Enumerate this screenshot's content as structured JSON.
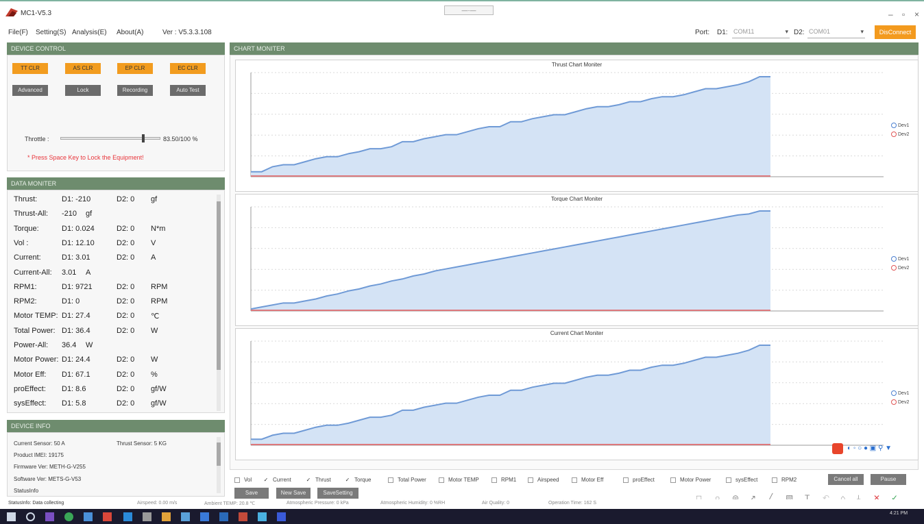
{
  "window": {
    "title": "MC1-V5.3",
    "grip": "—·—"
  },
  "menu": {
    "items": [
      "File(F)",
      "Setting(S)",
      "Analysis(E)",
      "About(A)"
    ],
    "version": "Ver : V5.3.3.108"
  },
  "port": {
    "label": "Port:",
    "d1_label": "D1:",
    "d1_value": "COM11",
    "d2_label": "D2:",
    "d2_value": "COM01",
    "disconnect": "DisConnect"
  },
  "device_control": {
    "header": "DEVICE CONTROL",
    "clear_buttons": [
      "TT CLR",
      "AS CLR",
      "EP CLR",
      "EC CLR"
    ],
    "mode_buttons": [
      "Advanced",
      "Lock",
      "Recording",
      "Auto Test"
    ],
    "throttle_label": "Throttle :",
    "throttle_value": "83.50/100 %",
    "throttle_fraction": 0.835,
    "warning": "* Press Space Key to Lock the Equipment!"
  },
  "data_monitor": {
    "header": "DATA MONITER",
    "rows": [
      {
        "label": "Thrust:",
        "d1": "D1: -210",
        "d2": "D2: 0",
        "unit": "gf"
      },
      {
        "label": "Thrust-All:",
        "d1": "-210",
        "d2": "",
        "unit": "gf"
      },
      {
        "label": "Torque:",
        "d1": "D1: 0.024",
        "d2": "D2: 0",
        "unit": "N*m"
      },
      {
        "label": "Vol :",
        "d1": "D1: 12.10",
        "d2": "D2: 0",
        "unit": "V"
      },
      {
        "label": "Current:",
        "d1": "D1: 3.01",
        "d2": "D2: 0",
        "unit": "A"
      },
      {
        "label": "Current-All:",
        "d1": "3.01",
        "d2": "",
        "unit": "A"
      },
      {
        "label": "RPM1:",
        "d1": "D1: 9721",
        "d2": "D2: 0",
        "unit": "RPM"
      },
      {
        "label": "RPM2:",
        "d1": "D1: 0",
        "d2": "D2: 0",
        "unit": "RPM"
      },
      {
        "label": "Motor TEMP:",
        "d1": "D1: 27.4",
        "d2": "D2: 0",
        "unit": "℃"
      },
      {
        "label": "Total Power:",
        "d1": "D1: 36.4",
        "d2": "D2: 0",
        "unit": "W"
      },
      {
        "label": "Power-All:",
        "d1": "36.4",
        "d2": "",
        "unit": "W"
      },
      {
        "label": "Motor Power:",
        "d1": "D1: 24.4",
        "d2": "D2: 0",
        "unit": "W"
      },
      {
        "label": "Motor Eff:",
        "d1": "D1: 67.1",
        "d2": "D2: 0",
        "unit": "%"
      },
      {
        "label": "proEffect:",
        "d1": "D1: 8.6",
        "d2": "D2: 0",
        "unit": "gf/W"
      },
      {
        "label": "sysEffect:",
        "d1": "D1: 5.8",
        "d2": "D2: 0",
        "unit": "gf/W"
      }
    ]
  },
  "device_info": {
    "header": "DEVICE INFO",
    "current_sensor": "Current Sensor: 50 A",
    "thrust_sensor": "Thrust Sensor: 5 KG",
    "product_imei": "Product IMEI: 19175",
    "firmware": "Firmware Ver: METH-G-V255",
    "software": "Software Ver: METS-G-V53",
    "status_info": "StatusInfo"
  },
  "chart_monitor": {
    "header": "CHART MONITER",
    "legend": [
      "Dev1",
      "Dev2"
    ],
    "colors": {
      "dev1": "#6f9ad6",
      "dev1_fill": "#d4e3f5",
      "dev2": "#e05555",
      "grid": "#d9d9d9"
    }
  },
  "chart_data": [
    {
      "type": "area",
      "title": "Thrust Chart Moniter",
      "series": [
        {
          "name": "Dev1",
          "values": [
            0.05,
            0.05,
            0.1,
            0.12,
            0.12,
            0.15,
            0.18,
            0.2,
            0.2,
            0.23,
            0.25,
            0.28,
            0.28,
            0.3,
            0.35,
            0.35,
            0.38,
            0.4,
            0.42,
            0.42,
            0.45,
            0.48,
            0.5,
            0.5,
            0.55,
            0.55,
            0.58,
            0.6,
            0.62,
            0.62,
            0.65,
            0.68,
            0.7,
            0.7,
            0.72,
            0.75,
            0.75,
            0.78,
            0.8,
            0.8,
            0.82,
            0.85,
            0.88,
            0.88,
            0.9,
            0.92,
            0.95,
            1.0,
            1.0
          ]
        },
        {
          "name": "Dev2",
          "values": [
            0,
            0,
            0,
            0,
            0,
            0,
            0,
            0,
            0,
            0,
            0,
            0,
            0,
            0,
            0,
            0,
            0,
            0,
            0,
            0,
            0,
            0,
            0,
            0,
            0,
            0,
            0,
            0,
            0,
            0,
            0,
            0,
            0,
            0,
            0,
            0,
            0,
            0,
            0,
            0,
            0,
            0,
            0,
            0,
            0,
            0,
            0,
            0,
            0
          ]
        }
      ]
    },
    {
      "type": "area",
      "title": "Torque Chart Moniter",
      "series": [
        {
          "name": "Dev1",
          "values": [
            0.02,
            0.04,
            0.06,
            0.08,
            0.08,
            0.1,
            0.12,
            0.15,
            0.17,
            0.2,
            0.22,
            0.25,
            0.27,
            0.3,
            0.32,
            0.35,
            0.37,
            0.4,
            0.42,
            0.44,
            0.46,
            0.48,
            0.5,
            0.52,
            0.54,
            0.56,
            0.58,
            0.6,
            0.62,
            0.64,
            0.66,
            0.68,
            0.7,
            0.72,
            0.74,
            0.76,
            0.78,
            0.8,
            0.82,
            0.84,
            0.86,
            0.88,
            0.9,
            0.92,
            0.94,
            0.96,
            0.97,
            1.0,
            1.0
          ]
        },
        {
          "name": "Dev2",
          "values": [
            0,
            0,
            0,
            0,
            0,
            0,
            0,
            0,
            0,
            0,
            0,
            0,
            0,
            0,
            0,
            0,
            0,
            0,
            0,
            0,
            0,
            0,
            0,
            0,
            0,
            0,
            0,
            0,
            0,
            0,
            0,
            0,
            0,
            0,
            0,
            0,
            0,
            0,
            0,
            0,
            0,
            0,
            0,
            0,
            0,
            0,
            0,
            0,
            0
          ]
        }
      ]
    },
    {
      "type": "area",
      "title": "Current Chart Moniter",
      "series": [
        {
          "name": "Dev1",
          "values": [
            0.06,
            0.06,
            0.1,
            0.12,
            0.12,
            0.15,
            0.18,
            0.2,
            0.2,
            0.22,
            0.25,
            0.28,
            0.28,
            0.3,
            0.35,
            0.35,
            0.38,
            0.4,
            0.42,
            0.42,
            0.45,
            0.48,
            0.5,
            0.5,
            0.55,
            0.55,
            0.58,
            0.6,
            0.62,
            0.62,
            0.65,
            0.68,
            0.7,
            0.7,
            0.72,
            0.75,
            0.75,
            0.78,
            0.8,
            0.8,
            0.82,
            0.85,
            0.88,
            0.88,
            0.9,
            0.92,
            0.95,
            1.0,
            1.0
          ]
        },
        {
          "name": "Dev2",
          "values": [
            0,
            0,
            0,
            0,
            0,
            0,
            0,
            0,
            0,
            0,
            0,
            0,
            0,
            0,
            0,
            0,
            0,
            0,
            0,
            0,
            0,
            0,
            0,
            0,
            0,
            0,
            0,
            0,
            0,
            0,
            0,
            0,
            0,
            0,
            0,
            0,
            0,
            0,
            0,
            0,
            0,
            0,
            0,
            0,
            0,
            0,
            0,
            0,
            0
          ]
        }
      ]
    }
  ],
  "checkboxes": [
    {
      "label": "Vol",
      "checked": false
    },
    {
      "label": "Current",
      "checked": true
    },
    {
      "label": "Thrust",
      "checked": true
    },
    {
      "label": "Torque",
      "checked": true
    },
    {
      "label": "Total Power",
      "checked": false
    },
    {
      "label": "Motor TEMP",
      "checked": false
    },
    {
      "label": "RPM1",
      "checked": false
    },
    {
      "label": "Airspeed",
      "checked": false
    },
    {
      "label": "Motor Eff",
      "checked": false
    },
    {
      "label": "proEffect",
      "checked": false
    },
    {
      "label": "Motor Power",
      "checked": false
    },
    {
      "label": "sysEffect",
      "checked": false
    },
    {
      "label": "RPM2",
      "checked": false
    }
  ],
  "bottom_buttons": {
    "cancel_all": "Cancel all",
    "pause": "Pause",
    "save": "Save",
    "new_save": "New Save",
    "save_setting": "SaveSetting"
  },
  "status": {
    "status_info": "StatusInfo: Data collecting",
    "airspeed": "Airspeed: 0.00 m/s",
    "ambient": "Ambient TEMP: 20.8 ℃",
    "pressure": "Atmospheric Pressure: 0 kPa",
    "humidity": "Atmospheric Humidity: 0 %RH",
    "air_quality": "Air Quality: 0",
    "operation_time": "Operation Time: 162 S"
  },
  "taskbar": {
    "time": "4:21 PM"
  }
}
